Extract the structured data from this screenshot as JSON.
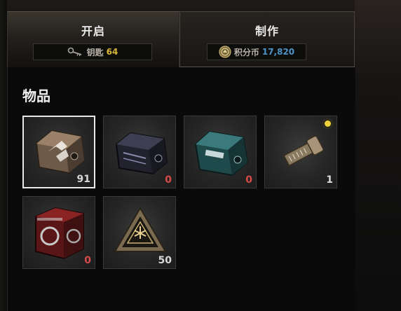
{
  "tabs": {
    "open": {
      "label": "开启",
      "badge_label": "钥匙",
      "badge_value": "64",
      "badge_icon": "key-icon"
    },
    "craft": {
      "label": "制作",
      "badge_label": "积分币",
      "badge_value": "17,820",
      "badge_icon": "credit-coin-icon"
    }
  },
  "section": {
    "title": "物品"
  },
  "items": [
    {
      "icon": "bronze-crate-icon",
      "count": "91",
      "count_color": "#d8d8d8",
      "selected": true
    },
    {
      "icon": "dark-crate-icon",
      "count": "0",
      "count_color": "#d84a4a",
      "selected": false
    },
    {
      "icon": "teal-crate-icon",
      "count": "0",
      "count_color": "#d84a4a",
      "selected": false
    },
    {
      "icon": "key-fragment-icon",
      "count": "1",
      "count_color": "#d8d8d8",
      "selected": false,
      "new": true
    },
    {
      "icon": "red-cube-crate-icon",
      "count": "0",
      "count_color": "#d84a4a",
      "selected": false
    },
    {
      "icon": "triangle-emblem-icon",
      "count": "50",
      "count_color": "#d8d8d8",
      "selected": false
    }
  ],
  "colors": {
    "key_count": "#d9b63a",
    "credit_count": "#4c94c8",
    "zero_count": "#d84a4a"
  }
}
